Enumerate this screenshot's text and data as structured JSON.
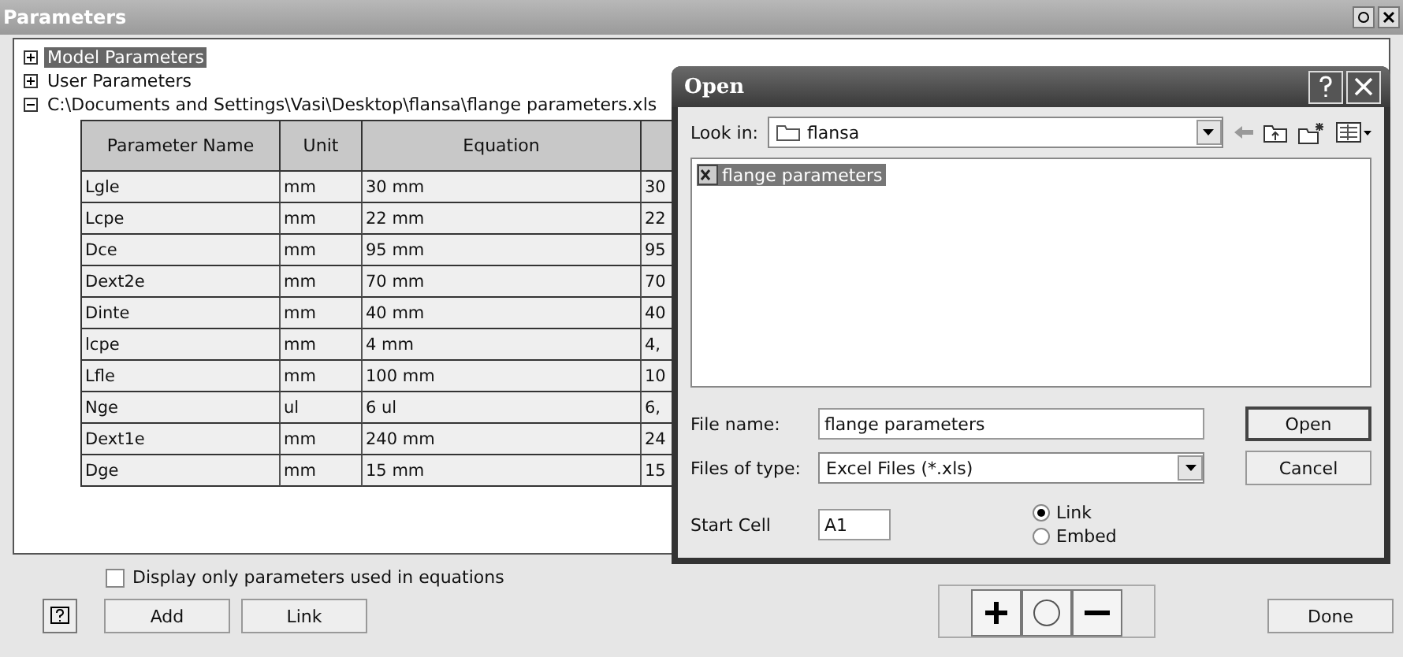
{
  "window": {
    "title": "Parameters"
  },
  "tree": [
    {
      "label": "Model Parameters",
      "expanded": false,
      "selected": true
    },
    {
      "label": "User Parameters",
      "expanded": false,
      "selected": false
    },
    {
      "label": "C:\\Documents and Settings\\Vasi\\Desktop\\flansa\\flange parameters.xls",
      "expanded": true,
      "selected": false
    }
  ],
  "table": {
    "columns": [
      "Parameter Name",
      "Unit",
      "Equation"
    ],
    "rows": [
      [
        "Lgle",
        "mm",
        "30 mm",
        "30"
      ],
      [
        "Lcpe",
        "mm",
        "22 mm",
        "22"
      ],
      [
        "Dce",
        "mm",
        "95 mm",
        "95"
      ],
      [
        "Dext2e",
        "mm",
        "70 mm",
        "70"
      ],
      [
        "Dinte",
        "mm",
        "40 mm",
        "40"
      ],
      [
        "lcpe",
        "mm",
        "4 mm",
        "4,"
      ],
      [
        "Lfle",
        "mm",
        "100 mm",
        "10"
      ],
      [
        "Nge",
        "ul",
        "6 ul",
        "6,"
      ],
      [
        "Dext1e",
        "mm",
        "240 mm",
        "24"
      ],
      [
        "Dge",
        "mm",
        "15 mm",
        "15"
      ]
    ]
  },
  "display_only_used": {
    "label": "Display only parameters used in equations",
    "checked": false
  },
  "buttons": [
    "Add",
    "Link"
  ],
  "done_button": "Done",
  "dialog": {
    "title": "Open",
    "look_in": {
      "label": "Look in:",
      "value": "flansa"
    },
    "files": [
      {
        "name": "flange parameters",
        "selected": true
      }
    ],
    "file_name": {
      "label": "File name:",
      "value": "flange parameters"
    },
    "files_of_type": {
      "label": "Files of type:",
      "value": "Excel Files (*.xls)"
    },
    "start_cell": {
      "label": "Start Cell",
      "value": "A1"
    },
    "options": [
      {
        "label": "Link",
        "selected": true
      },
      {
        "label": "Embed",
        "selected": false
      }
    ],
    "buttons": [
      "Open",
      "Cancel"
    ]
  }
}
